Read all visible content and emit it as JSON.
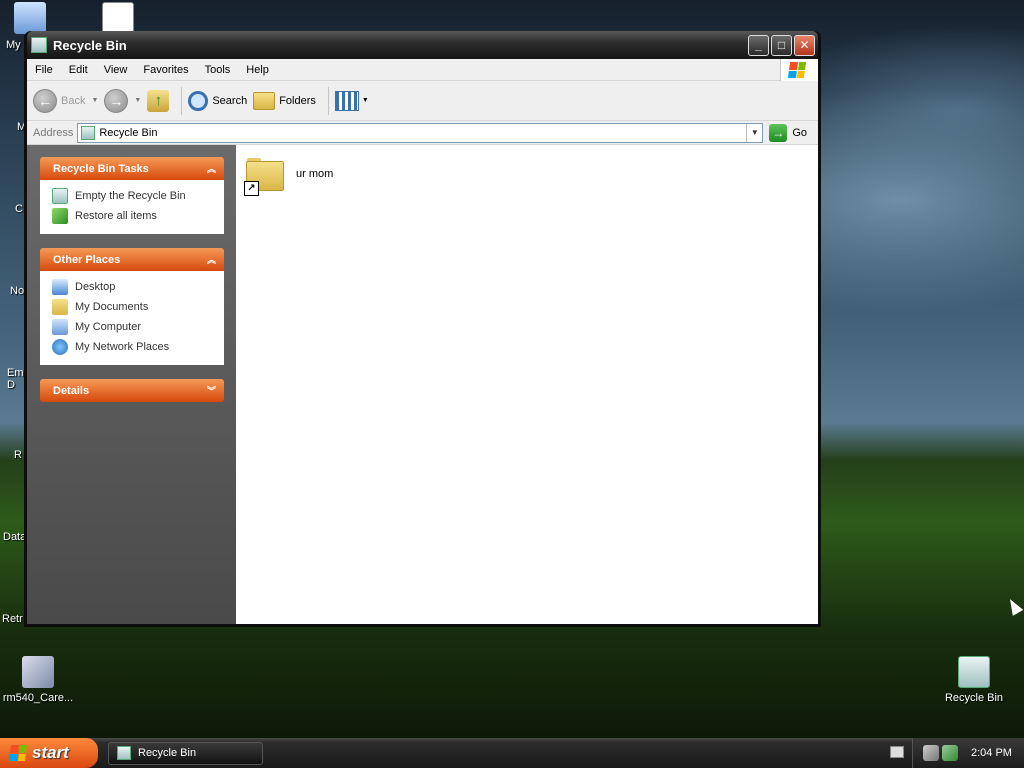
{
  "desktop": {
    "left_labels": [
      "My",
      "M",
      "C",
      "No",
      "Em\nD",
      "R",
      "Data",
      "Retr"
    ],
    "rm540_label": "rm540_Care...",
    "recycle_bin_label": "Recycle Bin"
  },
  "window": {
    "title": "Recycle Bin",
    "menu": [
      "File",
      "Edit",
      "View",
      "Favorites",
      "Tools",
      "Help"
    ],
    "toolbar": {
      "back": "Back",
      "search": "Search",
      "folders": "Folders"
    },
    "address": {
      "label": "Address",
      "value": "Recycle Bin",
      "go": "Go"
    },
    "tasks": {
      "title": "Recycle Bin Tasks",
      "items": [
        "Empty the Recycle Bin",
        "Restore all items"
      ]
    },
    "other_places": {
      "title": "Other Places",
      "items": [
        "Desktop",
        "My Documents",
        "My Computer",
        "My Network Places"
      ]
    },
    "details": {
      "title": "Details"
    },
    "files": [
      {
        "name": "ur mom",
        "type": "folder-shortcut"
      }
    ]
  },
  "taskbar": {
    "start": "start",
    "task_button": "Recycle Bin",
    "clock": "2:04 PM"
  },
  "colors": {
    "panel_header": "#d6490c",
    "task_pane": "#5a5a5a",
    "titlebar": "#1a1a1a"
  }
}
